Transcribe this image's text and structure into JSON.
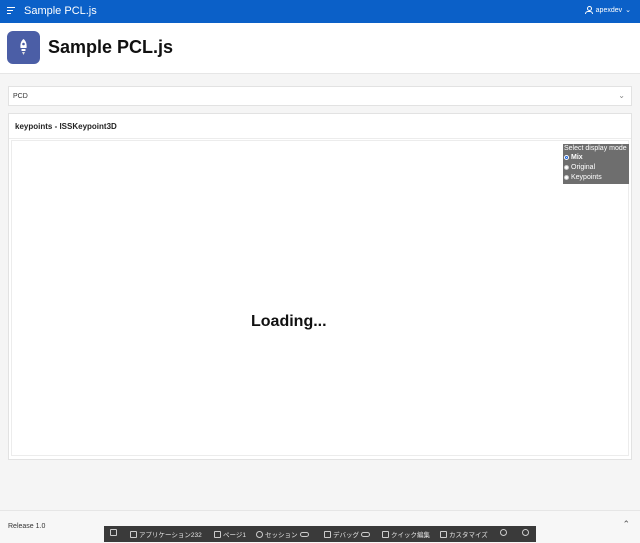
{
  "topbar": {
    "app_title": "Sample PCL.js",
    "user": "apexdev"
  },
  "header": {
    "page_title": "Sample PCL.js"
  },
  "pcd_region": {
    "label": "PCD"
  },
  "keypoints_region": {
    "title": "keypoints - ISSKeypoint3D",
    "loading_text": "Loading...",
    "display_mode": {
      "title": "Select display mode",
      "options": [
        "Mix",
        "Original",
        "Keypoints"
      ],
      "selected": "Mix"
    }
  },
  "footer": {
    "release": "Release 1.0"
  },
  "devbar": {
    "items": [
      "アプリケーション232",
      "ページ1",
      "セッション",
      "デバッグ",
      "クイック編集",
      "カスタマイズ"
    ]
  },
  "colors": {
    "topbar": "#0b60c8",
    "app_icon": "#4b5ea6",
    "devbar": "#3a3a3a",
    "panel": "#6e6e6e"
  }
}
